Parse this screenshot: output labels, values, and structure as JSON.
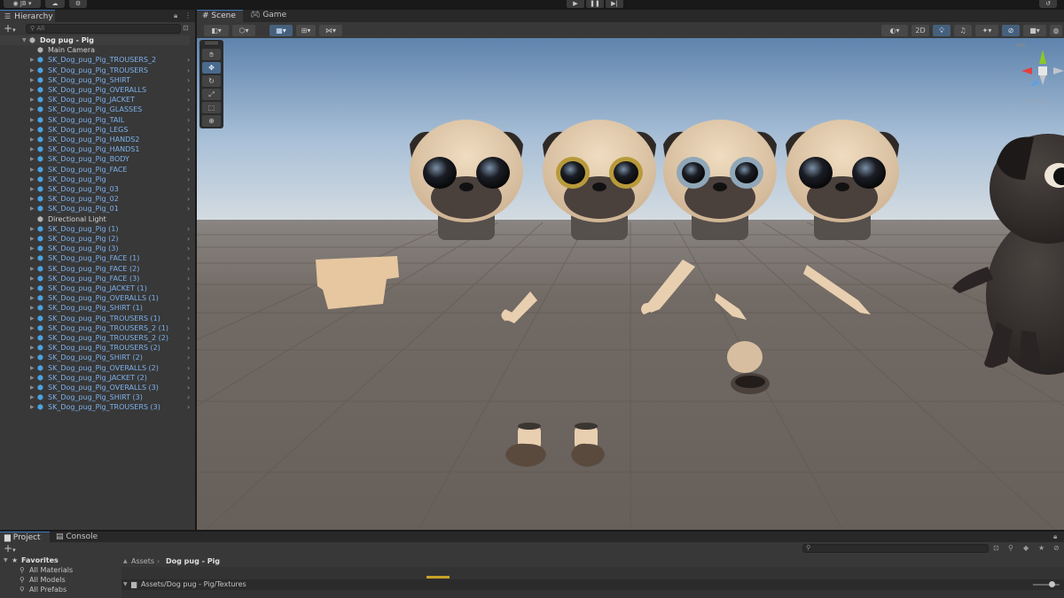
{
  "topbar": {
    "account_label": "JB",
    "cloud_icon": "cloud-icon",
    "settings_icon": "gear-icon",
    "play_icon": "play-icon",
    "pause_icon": "pause-icon",
    "step_icon": "step-icon",
    "history_icon": "history-icon"
  },
  "hierarchy": {
    "tab_label": "Hierarchy",
    "search_placeholder": "All",
    "items": [
      {
        "label": "Dog pug - Pig",
        "kind": "root"
      },
      {
        "label": "Main Camera",
        "kind": "plain"
      },
      {
        "label": "SK_Dog_pug_Pig_TROUSERS_2",
        "kind": "prefab"
      },
      {
        "label": "SK_Dog_pug_Pig_TROUSERS",
        "kind": "prefab"
      },
      {
        "label": "SK_Dog_pug_Pig_SHIRT",
        "kind": "prefab"
      },
      {
        "label": "SK_Dog_pug_Pig_OVERALLS",
        "kind": "prefab"
      },
      {
        "label": "SK_Dog_pug_Pig_JACKET",
        "kind": "prefab"
      },
      {
        "label": "SK_Dog_pug_Pig_GLASSES",
        "kind": "prefab"
      },
      {
        "label": "SK_Dog_pug_Pig_TAIL",
        "kind": "prefab"
      },
      {
        "label": "SK_Dog_pug_Pig_LEGS",
        "kind": "prefab"
      },
      {
        "label": "SK_Dog_pug_Pig_HANDS2",
        "kind": "prefab"
      },
      {
        "label": "SK_Dog_pug_Pig_HANDS1",
        "kind": "prefab"
      },
      {
        "label": "SK_Dog_pug_Pig_BODY",
        "kind": "prefab"
      },
      {
        "label": "SK_Dog_pug_Pig_FACE",
        "kind": "prefab"
      },
      {
        "label": "SK_Dog_pug_Pig",
        "kind": "prefab"
      },
      {
        "label": "SK_Dog_pug_Pig_03",
        "kind": "prefab"
      },
      {
        "label": "SK_Dog_pug_Pig_02",
        "kind": "prefab"
      },
      {
        "label": "SK_Dog_pug_Pig_01",
        "kind": "prefab"
      },
      {
        "label": "Directional Light",
        "kind": "plain"
      },
      {
        "label": "SK_Dog_pug_Pig (1)",
        "kind": "prefab"
      },
      {
        "label": "SK_Dog_pug_Pig (2)",
        "kind": "prefab"
      },
      {
        "label": "SK_Dog_pug_Pig (3)",
        "kind": "prefab"
      },
      {
        "label": "SK_Dog_pug_Pig_FACE (1)",
        "kind": "prefab"
      },
      {
        "label": "SK_Dog_pug_Pig_FACE (2)",
        "kind": "prefab"
      },
      {
        "label": "SK_Dog_pug_Pig_FACE (3)",
        "kind": "prefab"
      },
      {
        "label": "SK_Dog_pug_Pig_JACKET (1)",
        "kind": "prefab"
      },
      {
        "label": "SK_Dog_pug_Pig_OVERALLS (1)",
        "kind": "prefab"
      },
      {
        "label": "SK_Dog_pug_Pig_SHIRT (1)",
        "kind": "prefab"
      },
      {
        "label": "SK_Dog_pug_Pig_TROUSERS (1)",
        "kind": "prefab"
      },
      {
        "label": "SK_Dog_pug_Pig_TROUSERS_2 (1)",
        "kind": "prefab"
      },
      {
        "label": "SK_Dog_pug_Pig_TROUSERS_2 (2)",
        "kind": "prefab"
      },
      {
        "label": "SK_Dog_pug_Pig_TROUSERS (2)",
        "kind": "prefab"
      },
      {
        "label": "SK_Dog_pug_Pig_SHIRT (2)",
        "kind": "prefab"
      },
      {
        "label": "SK_Dog_pug_Pig_OVERALLS (2)",
        "kind": "prefab"
      },
      {
        "label": "SK_Dog_pug_Pig_JACKET (2)",
        "kind": "prefab"
      },
      {
        "label": "SK_Dog_pug_Pig_OVERALLS (3)",
        "kind": "prefab"
      },
      {
        "label": "SK_Dog_pug_Pig_SHIRT (3)",
        "kind": "prefab"
      },
      {
        "label": "SK_Dog_pug_Pig_TROUSERS (3)",
        "kind": "prefab"
      }
    ]
  },
  "scene": {
    "tabs": [
      {
        "label": "Scene",
        "active": true
      },
      {
        "label": "Game",
        "active": false
      }
    ],
    "toggle_2d_label": "2D",
    "gizmo_label": "Persp"
  },
  "project": {
    "tabs": [
      {
        "label": "Project",
        "active": true
      },
      {
        "label": "Console",
        "active": false
      }
    ],
    "favorites_label": "Favorites",
    "favorites": [
      "All Materials",
      "All Models",
      "All Prefabs"
    ],
    "breadcrumb": [
      "Assets",
      "Dog pug - Pig"
    ],
    "path": "Assets/Dog pug - Pig/Textures"
  },
  "colors": {
    "accent": "#3a79bb",
    "panel": "#383838",
    "prefab_text": "#7cb1ec",
    "prefab_icon": "#4ba3e3",
    "sky_top": "#5e83ad",
    "sky_horizon": "#d6dde2",
    "ground": "#6f6760",
    "pug_skin": "#e6cfb0",
    "pug_mask": "#4a403c",
    "black_pug": "#302b29"
  }
}
